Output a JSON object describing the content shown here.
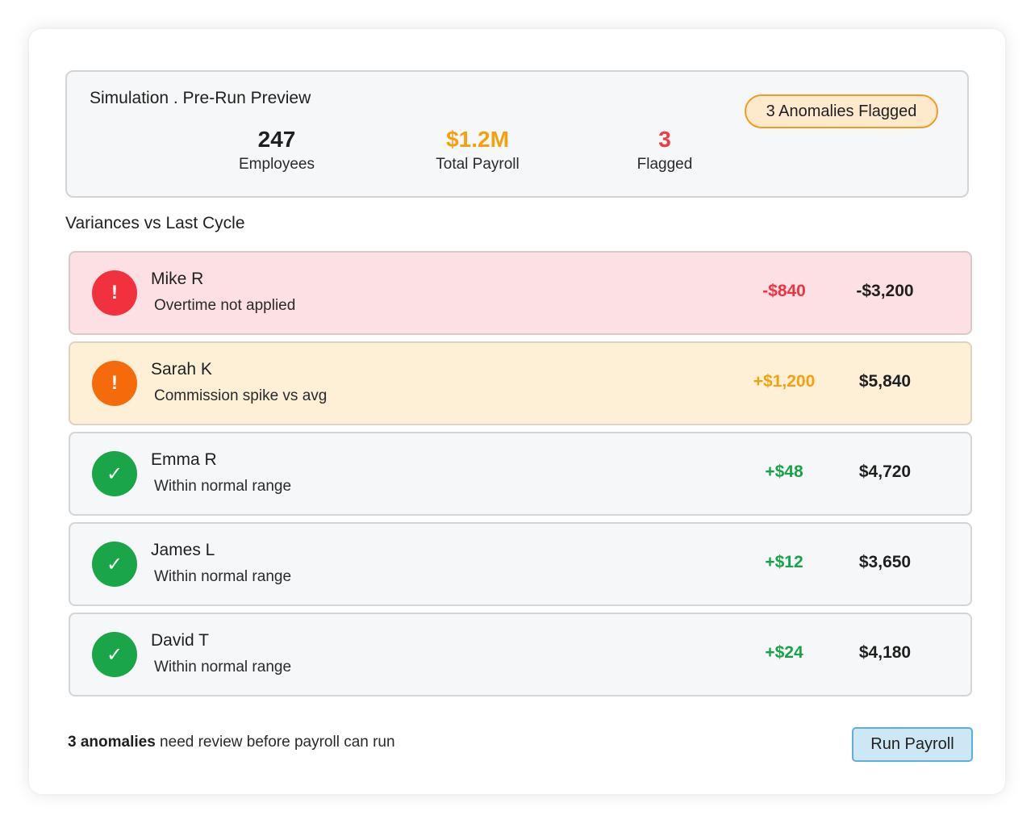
{
  "summary": {
    "title": "Simulation . Pre-Run Preview",
    "badge": "3 Anomalies Flagged",
    "stats": [
      {
        "value": "247",
        "label": "Employees",
        "color": "#1f1f1f"
      },
      {
        "value": "$1.2M",
        "label": "Total Payroll",
        "color": "#f5a00f"
      },
      {
        "value": "3",
        "label": "Flagged",
        "color": "#f03a44"
      }
    ]
  },
  "section_title": "Variances vs Last Cycle",
  "rows": [
    {
      "name": "Mike R",
      "note": "Overtime not applied",
      "variance": "-$840",
      "total": "-$3,200",
      "status": "critical",
      "icon": "exclamation-icon",
      "glyph": "!",
      "icon_color": "#f2313f",
      "variance_color": "#ef3340"
    },
    {
      "name": "Sarah K",
      "note": "Commission spike vs avg",
      "variance": "+$1,200",
      "total": "$5,840",
      "status": "warning",
      "icon": "exclamation-icon",
      "glyph": "!",
      "icon_color": "#f56a0a",
      "variance_color": "#f5a00f"
    },
    {
      "name": "Emma R",
      "note": "Within normal range",
      "variance": "+$48",
      "total": "$4,720",
      "status": "ok",
      "icon": "checkmark-icon",
      "glyph": "✓",
      "icon_color": "#1aa548",
      "variance_color": "#18a347"
    },
    {
      "name": "James L",
      "note": "Within normal range",
      "variance": "+$12",
      "total": "$3,650",
      "status": "ok",
      "icon": "checkmark-icon",
      "glyph": "✓",
      "icon_color": "#1aa548",
      "variance_color": "#18a347"
    },
    {
      "name": "David T",
      "note": "Within normal range",
      "variance": "+$24",
      "total": "$4,180",
      "status": "ok",
      "icon": "checkmark-icon",
      "glyph": "✓",
      "icon_color": "#1aa548",
      "variance_color": "#18a347"
    }
  ],
  "footer": {
    "note_bold": "3 anomalies",
    "note_rest": " need review before payroll can run",
    "run_button": "Run Payroll"
  }
}
